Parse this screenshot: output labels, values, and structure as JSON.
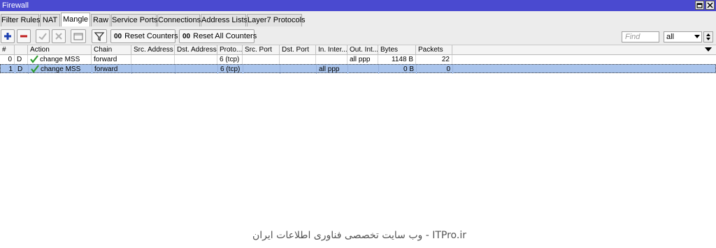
{
  "window": {
    "title": "Firewall"
  },
  "tabs": [
    {
      "label": "Filter Rules",
      "active": false
    },
    {
      "label": "NAT",
      "active": false
    },
    {
      "label": "Mangle",
      "active": true
    },
    {
      "label": "Raw",
      "active": false
    },
    {
      "label": "Service Ports",
      "active": false
    },
    {
      "label": "Connections",
      "active": false
    },
    {
      "label": "Address Lists",
      "active": false
    },
    {
      "label": "Layer7 Protocols",
      "active": false
    }
  ],
  "toolbar": {
    "reset_counters": "Reset Counters",
    "reset_all_counters": "Reset All Counters",
    "counter_prefix": "00",
    "icons": [
      "add-icon",
      "remove-icon",
      "enable-icon",
      "disable-icon",
      "comment-icon",
      "filter-icon"
    ],
    "find_placeholder": "Find",
    "filter_value": "all"
  },
  "table": {
    "columns": [
      "#",
      "",
      "Action",
      "Chain",
      "Src. Address",
      "Dst. Address",
      "Proto...",
      "Src. Port",
      "Dst. Port",
      "In. Inter...",
      "Out. Int...",
      "Bytes",
      "Packets"
    ],
    "rows": [
      {
        "num": "0",
        "flag": "D",
        "action": "change MSS",
        "chain": "forward",
        "src_address": "",
        "dst_address": "",
        "protocol": "6 (tcp)",
        "src_port": "",
        "dst_port": "",
        "in_interface": "",
        "out_interface": "all ppp",
        "bytes": "1148 B",
        "packets": "22",
        "selected": false
      },
      {
        "num": "1",
        "flag": "D",
        "action": "change MSS",
        "chain": "forward",
        "src_address": "",
        "dst_address": "",
        "protocol": "6 (tcp)",
        "src_port": "",
        "dst_port": "",
        "in_interface": "all ppp",
        "out_interface": "",
        "bytes": "0 B",
        "packets": "0",
        "selected": true
      }
    ]
  },
  "watermark": "ITPro.ir - وب سایت تخصصی فناوری اطلاعات ایران",
  "colors": {
    "titlebar": "#4a4ad0",
    "selected_row": "#a9c4ec",
    "check": "#2e9c2e",
    "add": "#1b3fb0",
    "remove": "#c02020"
  }
}
